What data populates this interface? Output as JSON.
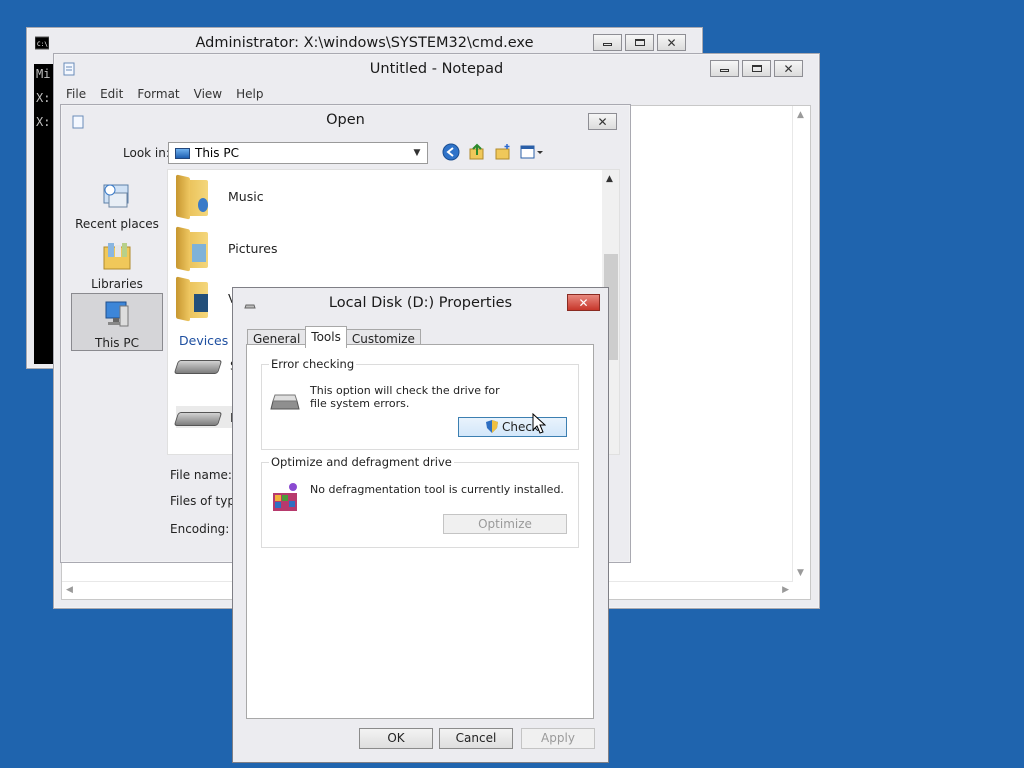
{
  "cmd": {
    "title": "Administrator: X:\\windows\\SYSTEM32\\cmd.exe",
    "lines": [
      "Mi",
      "",
      "",
      "X:",
      "",
      "X:"
    ]
  },
  "notepad": {
    "title": "Untitled - Notepad",
    "menu": [
      "File",
      "Edit",
      "Format",
      "View",
      "Help"
    ]
  },
  "open_dialog": {
    "title": "Open",
    "look_in_label": "Look in:",
    "look_in_value": "This PC",
    "places": [
      {
        "label": "Recent places"
      },
      {
        "label": "Libraries"
      },
      {
        "label": "This PC"
      }
    ],
    "files": [
      {
        "name": "Music"
      },
      {
        "name": "Pictures"
      },
      {
        "name": "V"
      }
    ],
    "devices_heading": "Devices ar",
    "drive_labels": [
      "S",
      "L"
    ],
    "file_name_label": "File name:",
    "files_of_type_label": "Files of type:",
    "encoding_label": "Encoding:"
  },
  "properties": {
    "title": "Local Disk (D:) Properties",
    "tabs": [
      "General",
      "Tools",
      "Customize"
    ],
    "active_tab": "Tools",
    "error_checking": {
      "title": "Error checking",
      "description": "This option will check the drive for file system errors.",
      "button": "Check"
    },
    "optimize": {
      "title": "Optimize and defragment drive",
      "description": "No defragmentation tool is currently installed.",
      "button": "Optimize"
    },
    "buttons": {
      "ok": "OK",
      "cancel": "Cancel",
      "apply": "Apply"
    }
  },
  "colors": {
    "desktop": "#1f64ae",
    "accent": "#3c7fb1"
  }
}
